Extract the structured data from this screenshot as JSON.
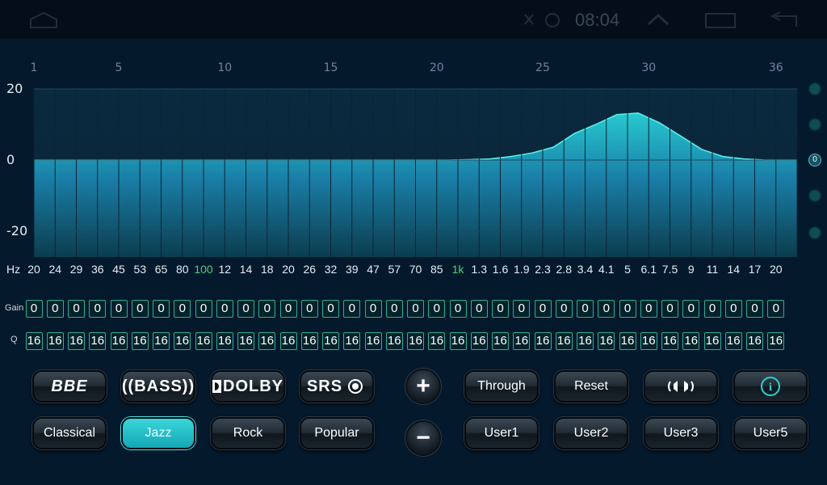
{
  "status_bar": {
    "time": "08:04"
  },
  "band_numbers": [
    "1",
    "5",
    "10",
    "15",
    "20",
    "25",
    "30",
    "36"
  ],
  "y_labels": [
    "20",
    "0",
    "-20"
  ],
  "freq_label": "Hz",
  "frequencies": [
    "20",
    "24",
    "29",
    "36",
    "45",
    "53",
    "65",
    "80",
    "100",
    "12",
    "14",
    "18",
    "20",
    "26",
    "32",
    "39",
    "47",
    "57",
    "70",
    "85",
    "1k",
    "1.3",
    "1.6",
    "1.9",
    "2.3",
    "2.8",
    "3.4",
    "4.1",
    "5",
    "6.1",
    "7.5",
    "9",
    "11",
    "14",
    "17",
    "20"
  ],
  "highlighted_frequencies": [
    "100",
    "1k"
  ],
  "gain_label": "Gain",
  "q_label": "Q",
  "gain_values": [
    "0",
    "0",
    "0",
    "0",
    "0",
    "0",
    "0",
    "0",
    "0",
    "0",
    "0",
    "0",
    "0",
    "0",
    "0",
    "0",
    "0",
    "0",
    "0",
    "0",
    "0",
    "0",
    "0",
    "0",
    "0",
    "0",
    "0",
    "0",
    "0",
    "0",
    "0",
    "0",
    "0",
    "0",
    "0",
    "0"
  ],
  "q_values": [
    "16",
    "16",
    "16",
    "16",
    "16",
    "16",
    "16",
    "16",
    "16",
    "16",
    "16",
    "16",
    "16",
    "16",
    "16",
    "16",
    "16",
    "16",
    "16",
    "16",
    "16",
    "16",
    "16",
    "16",
    "16",
    "16",
    "16",
    "16",
    "16",
    "16",
    "16",
    "16",
    "16",
    "16",
    "16",
    "16"
  ],
  "chart_data": {
    "type": "area",
    "ylim": [
      -20,
      20
    ],
    "y_ticks": [
      20,
      0,
      -20
    ],
    "curve": [
      0,
      0,
      0,
      0,
      0,
      0,
      0,
      0,
      0,
      0,
      0,
      0,
      0,
      0,
      0,
      0,
      0,
      0,
      0,
      0,
      0.1,
      0.3,
      1,
      2,
      3.6,
      7.5,
      10,
      12.8,
      13.2,
      10.5,
      6.8,
      3,
      1,
      0.3,
      0,
      0
    ]
  },
  "right_indicator": "0",
  "buttons": {
    "bbe": "BBE",
    "bass": "((BASS))",
    "dolby": "DOLBY",
    "srs": "SRS",
    "plus": "+",
    "minus": "−",
    "through": "Through",
    "reset": "Reset",
    "info": "i",
    "classical": "Classical",
    "jazz": "Jazz",
    "rock": "Rock",
    "popular": "Popular",
    "user1": "User1",
    "user2": "User2",
    "user3": "User3",
    "user5": "User5"
  },
  "colors": {
    "accent": "#2bd3d3",
    "highlight": "#46d37a",
    "background": "#05192d"
  },
  "icons": [
    "home-icon",
    "signal-icon",
    "up-icon",
    "window-icon",
    "back-icon",
    "speaker-icon",
    "info-icon"
  ]
}
